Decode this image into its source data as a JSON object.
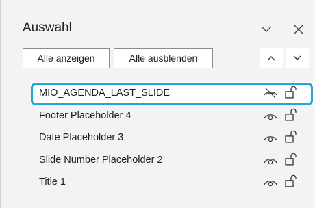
{
  "pane": {
    "title": "Auswahl",
    "options_icon": "chevron-down-icon",
    "close_icon": "close-icon"
  },
  "toolbar": {
    "show_all_label": "Alle anzeigen",
    "hide_all_label": "Alle ausblenden",
    "bring_forward_icon": "chevron-up-icon",
    "send_backward_icon": "chevron-down-icon"
  },
  "items": [
    {
      "label": "MIO_AGENDA_LAST_SLIDE",
      "visible": false,
      "locked": false,
      "selected": true
    },
    {
      "label": "Footer Placeholder 4",
      "visible": true,
      "locked": false,
      "selected": false
    },
    {
      "label": "Date Placeholder 3",
      "visible": true,
      "locked": false,
      "selected": false
    },
    {
      "label": "Slide Number Placeholder 2",
      "visible": true,
      "locked": false,
      "selected": false
    },
    {
      "label": "Title 1",
      "visible": true,
      "locked": false,
      "selected": false
    }
  ],
  "colors": {
    "pane_background": "#f3f3f3",
    "highlight_border": "#1ea7d8",
    "text": "#1f1f1f"
  }
}
